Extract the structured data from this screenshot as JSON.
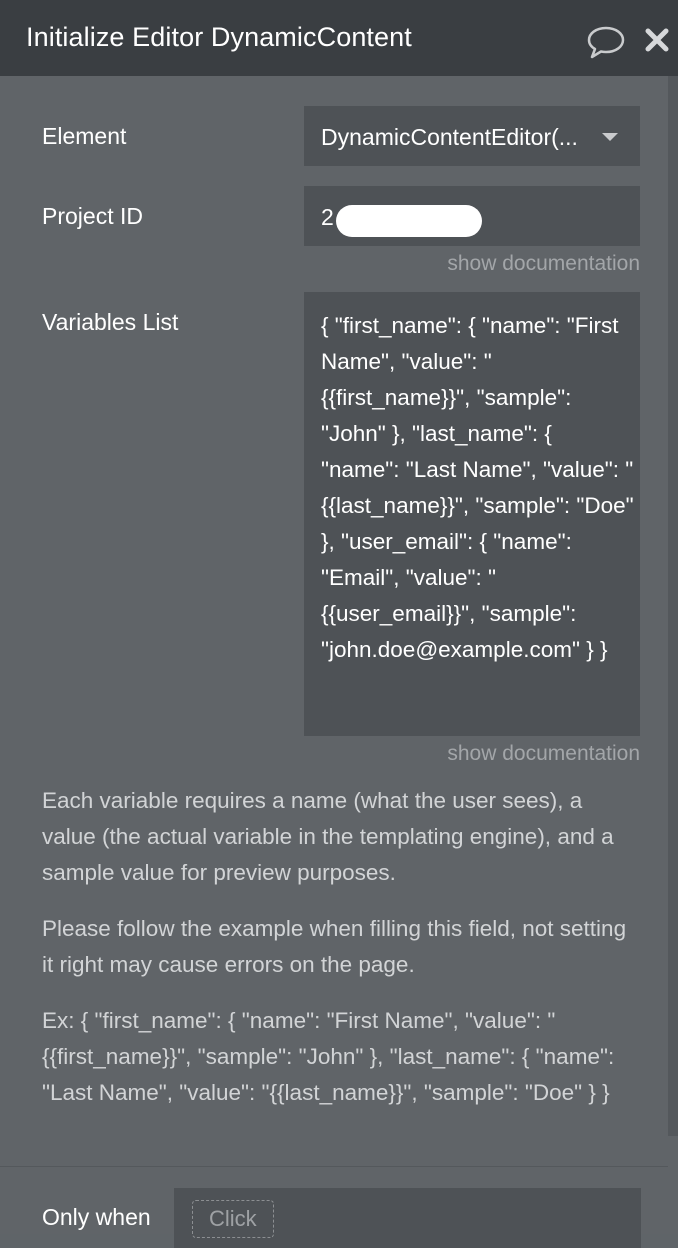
{
  "header": {
    "title": "Initialize Editor DynamicContent",
    "comment_icon": "speech-bubble-icon",
    "close_icon": "close-x-icon"
  },
  "fields": {
    "element": {
      "label": "Element",
      "value": "DynamicContentEditor(..."
    },
    "project_id": {
      "label": "Project ID",
      "value": "2"
    },
    "variables_list": {
      "label": "Variables List",
      "value": "{ \"first_name\": { \"name\": \"First Name\", \"value\": \"{{first_name}}\", \"sample\": \"John\" }, \"last_name\": { \"name\": \"Last Name\", \"value\": \"{{last_name}}\", \"sample\": \"Doe\" }, \"user_email\": { \"name\": \"Email\", \"value\": \"{{user_email}}\", \"sample\": \"john.doe@example.com\" } }"
    }
  },
  "show_documentation": "show documentation",
  "help": {
    "p1": "Each variable requires a name (what the user sees), a value (the actual variable in the templating engine), and a sample value for preview purposes.",
    "p2": "Please follow the example when filling this field, not setting it right may cause errors on the page.",
    "p3": "Ex: { \"first_name\": { \"name\": \"First Name\", \"value\": \"{{first_name}}\", \"sample\": \"John\" }, \"last_name\": { \"name\": \"Last Name\", \"value\": \"{{last_name}}\", \"sample\": \"Doe\" } }"
  },
  "only_when": {
    "label": "Only when",
    "placeholder": "Click"
  },
  "colors": {
    "panel_bg": "#606468",
    "header_bg": "#3a3e42",
    "field_bg": "#4e5256",
    "muted_text": "#a3a6a9"
  }
}
